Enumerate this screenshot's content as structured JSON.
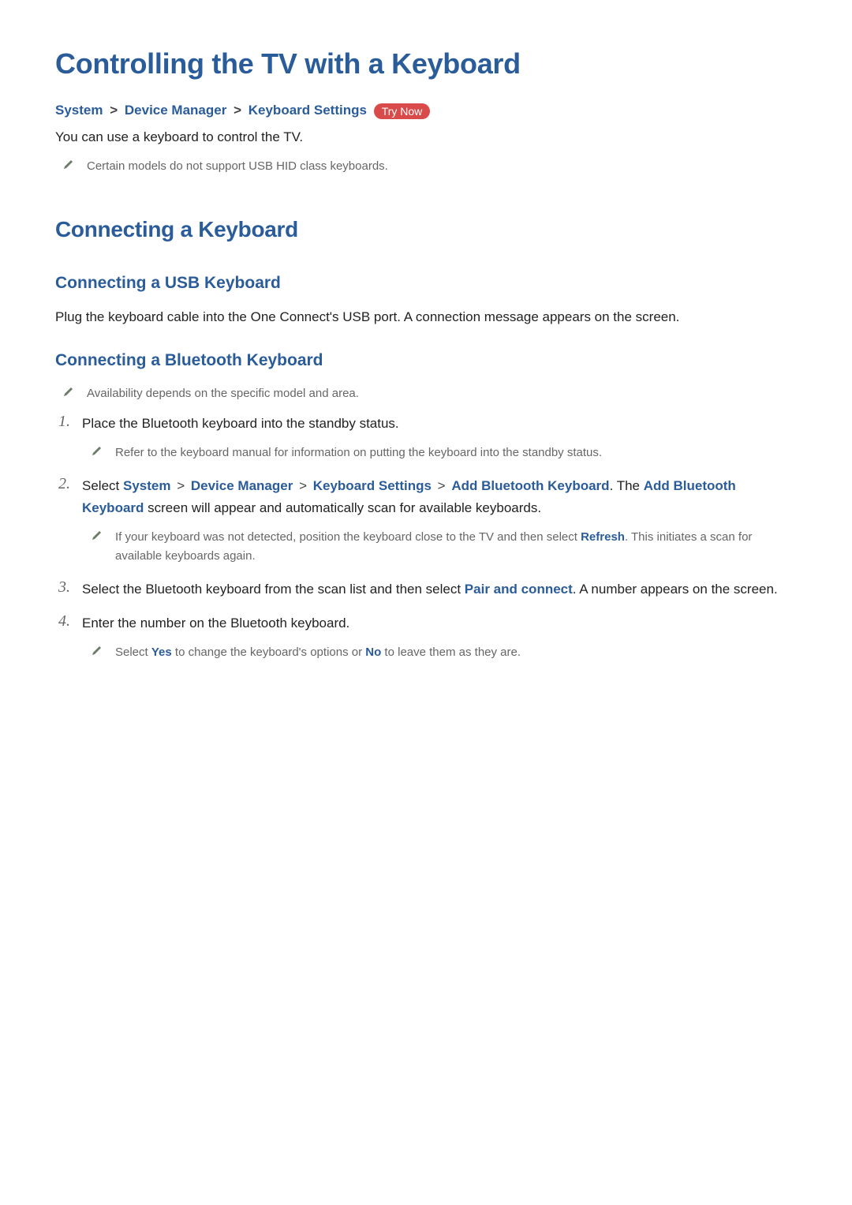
{
  "page": {
    "title": "Controlling the TV with a Keyboard"
  },
  "breadcrumb": {
    "item1": "System",
    "item2": "Device Manager",
    "item3": "Keyboard Settings",
    "try_now": "Try Now",
    "sep": ">"
  },
  "intro": {
    "line1": "You can use a keyboard to control the TV.",
    "note1": "Certain models do not support USB HID class keyboards."
  },
  "sections": {
    "connecting": {
      "heading": "Connecting a Keyboard",
      "usb": {
        "heading": "Connecting a USB Keyboard",
        "body": "Plug the keyboard cable into the One Connect's USB port. A connection message appears on the screen."
      },
      "bluetooth": {
        "heading": "Connecting a Bluetooth Keyboard",
        "note_top": "Availability depends on the specific model and area.",
        "step1": {
          "text": "Place the Bluetooth keyboard into the standby status.",
          "subnote": "Refer to the keyboard manual for information on putting the keyboard into the standby status."
        },
        "step2": {
          "prefix": "Select ",
          "bc1": "System",
          "bc2": "Device Manager",
          "bc3": "Keyboard Settings",
          "bc4": "Add Bluetooth Keyboard",
          "mid": ". The ",
          "emph2": "Add Bluetooth Keyboard",
          "suffix": " screen will appear and automatically scan for available keyboards.",
          "subnote_pre": "If your keyboard was not detected, position the keyboard close to the TV and then select ",
          "subnote_emph": "Refresh",
          "subnote_post": ". This initiates a scan for available keyboards again."
        },
        "step3": {
          "prefix": "Select the Bluetooth keyboard from the scan list and then select ",
          "emph": "Pair and connect",
          "suffix": ". A number appears on the screen."
        },
        "step4": {
          "text": "Enter the number on the Bluetooth keyboard.",
          "subnote_pre": "Select ",
          "subnote_yes": "Yes",
          "subnote_mid": " to change the keyboard's options or ",
          "subnote_no": "No",
          "subnote_post": " to leave them as they are."
        }
      }
    }
  }
}
